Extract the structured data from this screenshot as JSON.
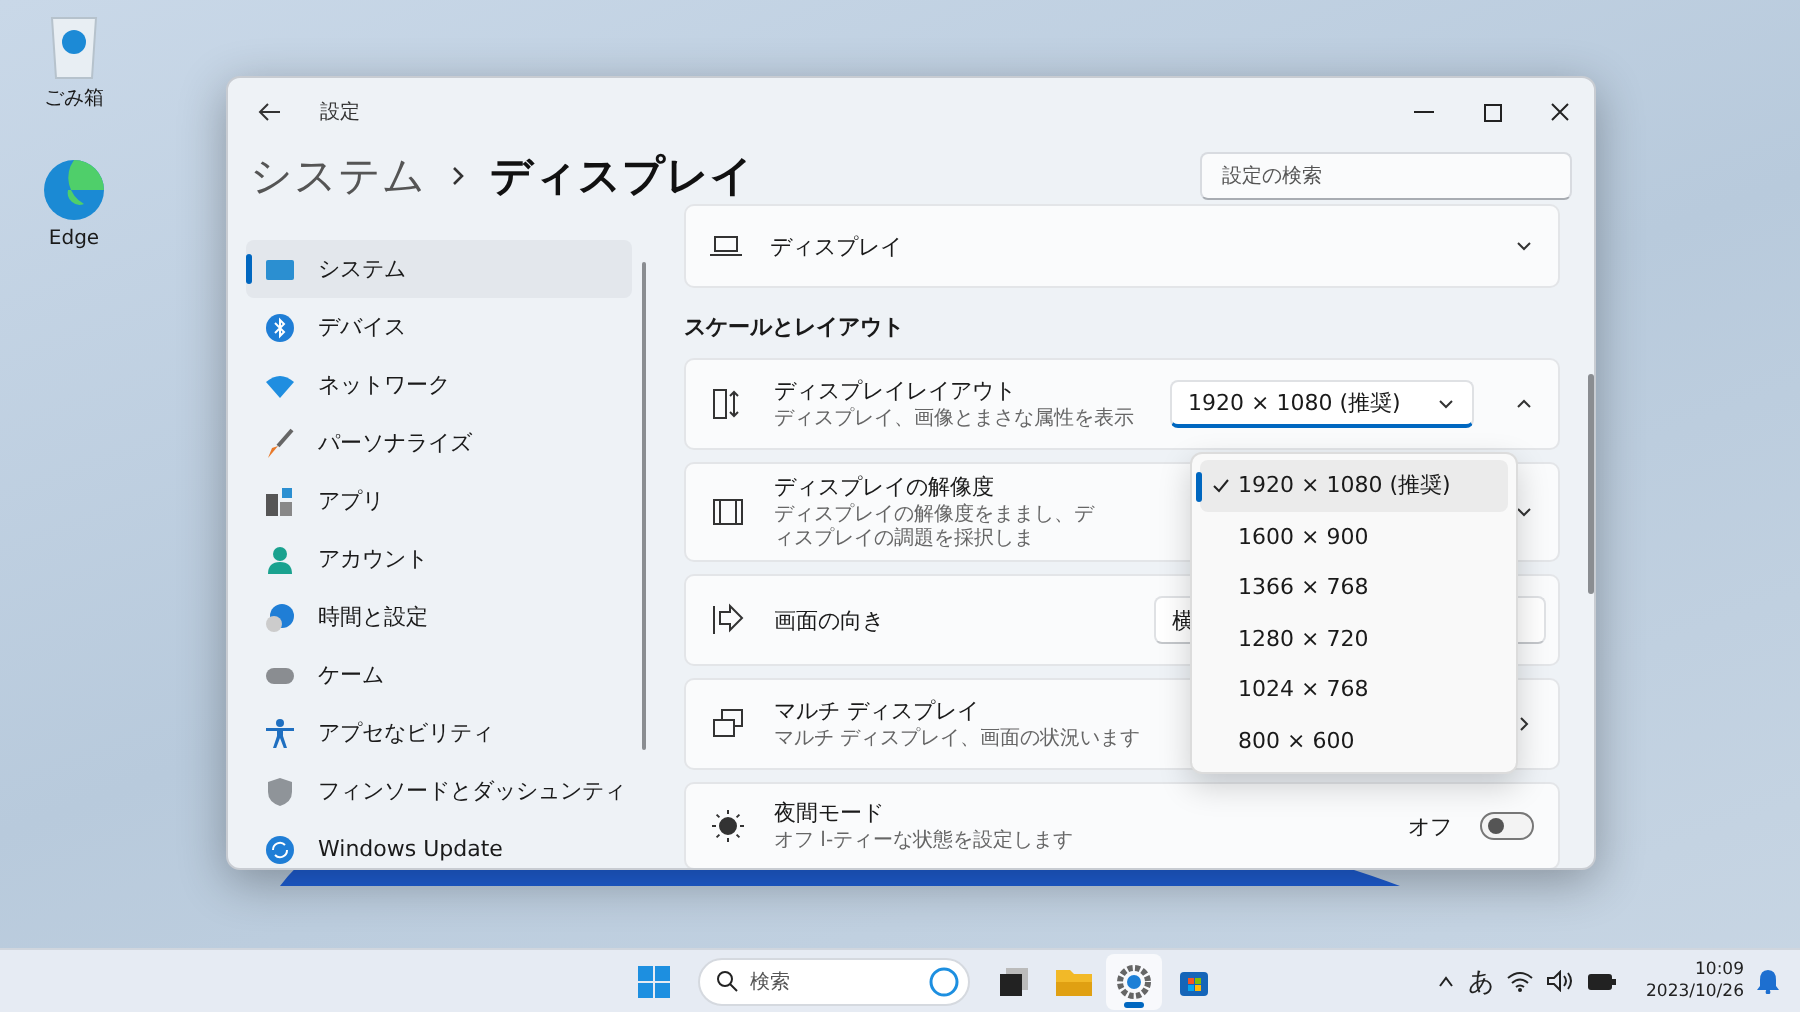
{
  "desktop": {
    "icons": [
      {
        "label": "ごみ箱"
      },
      {
        "label": "Edge"
      }
    ]
  },
  "window": {
    "app_title": "設定",
    "breadcrumb": {
      "parent": "システム",
      "current": "ディスプレイ"
    },
    "search": {
      "placeholder": "設定の検索"
    }
  },
  "sidebar": {
    "items": [
      {
        "label": "システム",
        "selected": true
      },
      {
        "label": "デバイス",
        "selected": false
      },
      {
        "label": "ネットワーク",
        "selected": false
      },
      {
        "label": "パーソナライズ",
        "selected": false
      },
      {
        "label": "アプリ",
        "selected": false
      },
      {
        "label": "アカウント",
        "selected": false
      },
      {
        "label": "時間と設定",
        "selected": false
      },
      {
        "label": "ケーム",
        "selected": false
      },
      {
        "label": "アプセなビリティ",
        "selected": false
      },
      {
        "label": "フィンソードとダッシュンティ",
        "selected": false
      },
      {
        "label": "Windows Update",
        "selected": false
      }
    ]
  },
  "content": {
    "top_card": {
      "title": "ディスプレイ",
      "expanded": false
    },
    "section_title": "スケールとレイアウト",
    "settings": [
      {
        "kind": "combo",
        "title": "ディスプレイレイアウト",
        "subtitle": "ディスプレイ、画像とまさな属性を表示",
        "value": "1920 × 1080 (推奨)",
        "expanded": true,
        "open": true,
        "options": [
          {
            "label": "1920 × 1080 (推奨)",
            "selected": true
          },
          {
            "label": "1600 × 900",
            "selected": false
          },
          {
            "label": "1366 × 768",
            "selected": false
          },
          {
            "label": "1280 × 720",
            "selected": false
          },
          {
            "label": "1024 × 768",
            "selected": false
          },
          {
            "label": "800 × 600",
            "selected": false
          }
        ]
      },
      {
        "kind": "expander",
        "title": "ディスプレイの解像度",
        "subtitle": "ディスプレイの解像度をままし、ディスプレイの調題を採択しま",
        "expanded": false
      },
      {
        "kind": "select",
        "title": "画面の向き",
        "value": "横"
      },
      {
        "kind": "link",
        "title": "マルチ ディスプレイ",
        "subtitle": "マルチ ディスプレイ、画面の状況います"
      },
      {
        "kind": "toggle",
        "title": "夜間モード",
        "subtitle": "オフ l-ティーな状態を設定します",
        "on": false,
        "state_label": "オフ"
      }
    ]
  },
  "taskbar": {
    "search_placeholder": "検索",
    "apps": [
      {
        "selected": false
      },
      {
        "selected": false
      },
      {
        "selected": true
      },
      {
        "selected": false
      }
    ],
    "tray": {
      "ime": "あ",
      "time": "10:09",
      "date": "2023/10/26"
    }
  }
}
